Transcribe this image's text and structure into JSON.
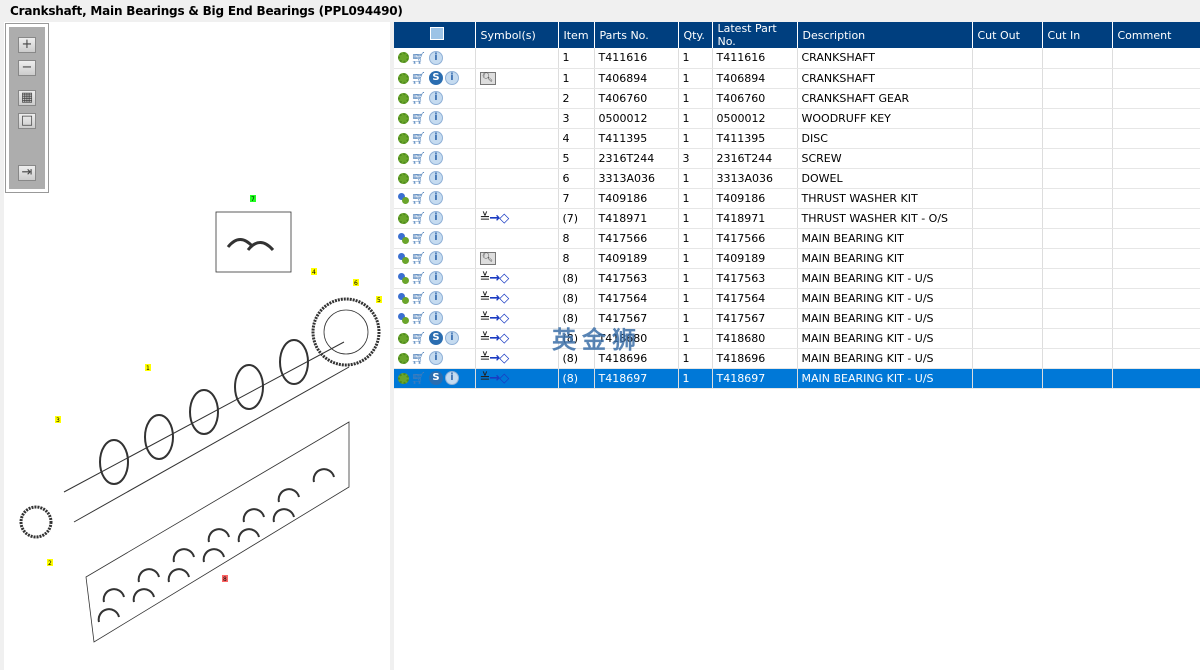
{
  "title": "Crankshaft, Main Bearings & Big End Bearings (PPL094490)",
  "toolbar": {
    "zoom_in": "+",
    "zoom_out": "−",
    "fit": "▦",
    "actual": "□",
    "panel": "⇥"
  },
  "diagram": {
    "callouts": [
      "7",
      "4",
      "6",
      "5",
      "1",
      "3",
      "2",
      "8"
    ]
  },
  "table": {
    "headers": [
      "",
      "Symbol(s)",
      "Item",
      "Parts No.",
      "Qty.",
      "Latest Part No.",
      "Description",
      "Cut Out",
      "Cut In",
      "Comment"
    ],
    "rows": [
      {
        "gear": "green",
        "s": false,
        "sym": "",
        "item": "1",
        "part": "T411616",
        "qty": "1",
        "latest": "T411616",
        "desc": "CRANKSHAFT"
      },
      {
        "gear": "green",
        "s": true,
        "sym": "book",
        "item": "1",
        "part": "T406894",
        "qty": "1",
        "latest": "T406894",
        "desc": "CRANKSHAFT"
      },
      {
        "gear": "green",
        "s": false,
        "sym": "",
        "item": "2",
        "part": "T406760",
        "qty": "1",
        "latest": "T406760",
        "desc": "CRANKSHAFT GEAR"
      },
      {
        "gear": "green",
        "s": false,
        "sym": "",
        "item": "3",
        "part": "0500012",
        "qty": "1",
        "latest": "0500012",
        "desc": "WOODRUFF KEY"
      },
      {
        "gear": "green",
        "s": false,
        "sym": "",
        "item": "4",
        "part": "T411395",
        "qty": "1",
        "latest": "T411395",
        "desc": "DISC"
      },
      {
        "gear": "green",
        "s": false,
        "sym": "",
        "item": "5",
        "part": "2316T244",
        "qty": "3",
        "latest": "2316T244",
        "desc": "SCREW"
      },
      {
        "gear": "green",
        "s": false,
        "sym": "",
        "item": "6",
        "part": "3313A036",
        "qty": "1",
        "latest": "3313A036",
        "desc": "DOWEL"
      },
      {
        "gear": "multi",
        "s": false,
        "sym": "",
        "item": "7",
        "part": "T409186",
        "qty": "1",
        "latest": "T409186",
        "desc": "THRUST WASHER KIT"
      },
      {
        "gear": "green",
        "s": false,
        "sym": "cut",
        "item": "(7)",
        "part": "T418971",
        "qty": "1",
        "latest": "T418971",
        "desc": "THRUST WASHER KIT - O/S"
      },
      {
        "gear": "multi",
        "s": false,
        "sym": "",
        "item": "8",
        "part": "T417566",
        "qty": "1",
        "latest": "T417566",
        "desc": "MAIN BEARING KIT"
      },
      {
        "gear": "multi",
        "s": false,
        "sym": "book",
        "item": "8",
        "part": "T409189",
        "qty": "1",
        "latest": "T409189",
        "desc": "MAIN BEARING KIT"
      },
      {
        "gear": "multi",
        "s": false,
        "sym": "cut",
        "item": "(8)",
        "part": "T417563",
        "qty": "1",
        "latest": "T417563",
        "desc": "MAIN BEARING KIT - U/S"
      },
      {
        "gear": "multi",
        "s": false,
        "sym": "cut",
        "item": "(8)",
        "part": "T417564",
        "qty": "1",
        "latest": "T417564",
        "desc": "MAIN BEARING KIT - U/S"
      },
      {
        "gear": "multi",
        "s": false,
        "sym": "cut",
        "item": "(8)",
        "part": "T417567",
        "qty": "1",
        "latest": "T417567",
        "desc": "MAIN BEARING KIT - U/S"
      },
      {
        "gear": "green",
        "s": true,
        "sym": "cut",
        "item": "(8)",
        "part": "T418680",
        "qty": "1",
        "latest": "T418680",
        "desc": "MAIN BEARING KIT - U/S"
      },
      {
        "gear": "green",
        "s": false,
        "sym": "cut",
        "item": "(8)",
        "part": "T418696",
        "qty": "1",
        "latest": "T418696",
        "desc": "MAIN BEARING KIT - U/S"
      },
      {
        "gear": "green",
        "s": true,
        "sym": "cut",
        "item": "(8)",
        "part": "T418697",
        "qty": "1",
        "latest": "T418697",
        "desc": "MAIN BEARING KIT - U/S",
        "selected": true
      }
    ]
  },
  "watermark": "英金狮",
  "colors": {
    "header": "#003f7f",
    "selected": "#0078d7"
  }
}
